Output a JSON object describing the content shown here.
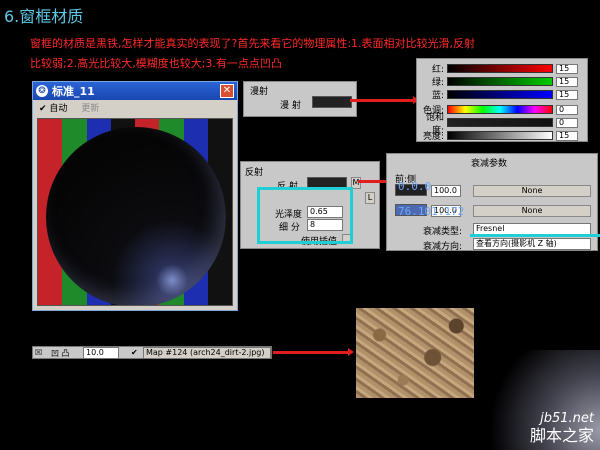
{
  "heading": "6.窗框材质",
  "intro": {
    "line1": "窗框的材质是黑铁,怎样才能真实的表现了?首先来看它的物理属性:1.表面相对比较光滑,反射",
    "line2": "比较弱;2.高光比较大,模糊度也较大;3.有一点点凹凸"
  },
  "material_window": {
    "title": "标准_11",
    "menu_auto": "自动",
    "menu_update": "更新"
  },
  "diffuse_panel": {
    "header": "漫射",
    "label": "漫 射"
  },
  "color_picker": {
    "rows": [
      {
        "label": "红:",
        "value": "15"
      },
      {
        "label": "绿:",
        "value": "15"
      },
      {
        "label": "蓝:",
        "value": "15"
      },
      {
        "label": "色调:",
        "value": "0"
      },
      {
        "label": "饱和度:",
        "value": "0"
      },
      {
        "label": "亮度:",
        "value": "15"
      }
    ]
  },
  "reflect_panel": {
    "header": "反射",
    "reflect_label": "反 射",
    "m_btn": "M",
    "l_btn": "L",
    "gloss_label": "光泽度",
    "gloss_value": "0.65",
    "subdiv_label": "细 分",
    "subdiv_value": "8",
    "interp_label": "使用插值"
  },
  "falloff_panel": {
    "header": "衰减参数",
    "side_label": "前:侧",
    "value1": "100.0",
    "value2": "100.0",
    "none1": "None",
    "none2": "None",
    "type_label": "衰减类型:",
    "type_value": "Fresnel",
    "dir_label": "衰减方向:",
    "dir_value": "查看方向(摄影机 Z 轴)"
  },
  "overlay": {
    "num1": "0.0.0",
    "num2": "76.101.172"
  },
  "map_row": {
    "label": "凹 凸",
    "amount": "10.0",
    "map_name": "Map #124 (arch24_dirt-2.jpg)"
  },
  "watermark": {
    "site": "jb51.net",
    "name": "脚本之家"
  },
  "colors": {
    "heading": "#5ec8e6",
    "intro": "#ff2a2a",
    "arrow": "#e21d1d",
    "cyan_box": "#1ed0d6"
  }
}
